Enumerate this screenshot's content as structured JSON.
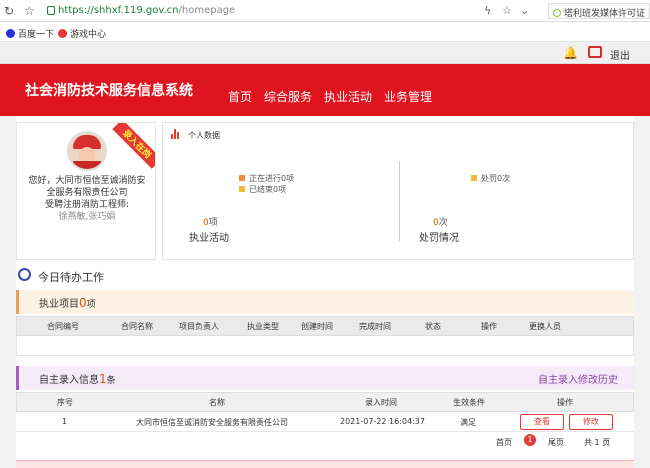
{
  "browser": {
    "url_host": "https://shhxf.119.gov.cn",
    "url_path": "/homepage",
    "extension_text": "塔利班发媒体许可证"
  },
  "bookmarks": [
    {
      "label": "百度一下",
      "icon": "baidu-paw-icon",
      "color": "#2932e1"
    },
    {
      "label": "游戏中心",
      "icon": "game-center-icon",
      "color": "#e53935"
    }
  ],
  "topbar": {
    "logout_label": "退出"
  },
  "header": {
    "system_title": "社会消防技术服务信息系统",
    "menu": [
      "首页",
      "综合服务",
      "执业活动",
      "业务管理"
    ]
  },
  "profile": {
    "ribbon": "录入在岗",
    "greeting_lines": [
      "您好，大同市恒信至诚消防安",
      "全服务有限责任公司",
      "受聘注册消防工程师:"
    ],
    "engineers": "徐燕敏,张巧娟"
  },
  "stats": {
    "title": "个人数据",
    "legend_left": [
      {
        "label": "正在进行0项",
        "color": "#f08c3e"
      },
      {
        "label": "已结束0项",
        "color": "#f5b942"
      }
    ],
    "legend_right": [
      {
        "label": "处罚0次",
        "color": "#f5b942"
      }
    ],
    "left_num": "0",
    "left_unit": "项",
    "left_label": "执业活动",
    "right_num": "0",
    "right_unit": "次",
    "right_label": "处罚情况"
  },
  "todo": {
    "title": "今日待办工作"
  },
  "projects": {
    "title": "执业项目",
    "count": "0",
    "unit": "项",
    "columns": [
      "合同编号",
      "合同名称",
      "项目负责人",
      "执业类型",
      "创建时间",
      "完成时间",
      "状态",
      "操作",
      "更换人员"
    ]
  },
  "records": {
    "title": "自主录入信息",
    "count": "1",
    "unit": "条",
    "history_link": "自主录入修改历史",
    "columns": [
      "序号",
      "名称",
      "录入时间",
      "生效条件",
      "操作"
    ],
    "row": {
      "index": "1",
      "name": "大同市恒信至诚消防安全服务有限责任公司",
      "time": "2021-07-22 16:04:37",
      "condition": "满足",
      "view_label": "查看",
      "edit_label": "修改"
    },
    "pager": {
      "first": "首页",
      "current": "1",
      "last": "尾页",
      "total_prefix": "共",
      "total": "1",
      "total_suffix": "页"
    }
  }
}
